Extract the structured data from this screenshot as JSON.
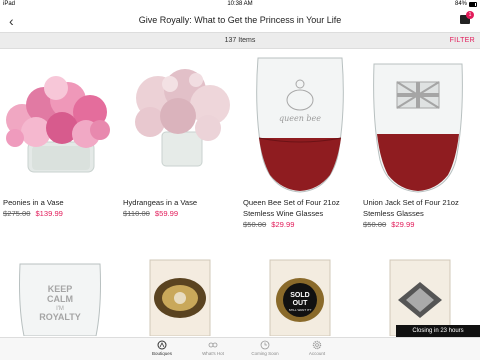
{
  "status_bar": {
    "carrier": "iPad",
    "time": "10:38 AM",
    "battery": "84%"
  },
  "nav": {
    "back_icon": "chevron-left",
    "title": "Give Royally: What to Get the Princess in Your Life",
    "cart_icon": "shopping-bag",
    "cart_count": "1"
  },
  "subbar": {
    "item_count": "137 Items",
    "filter_label": "FILTER"
  },
  "products": [
    {
      "title": "Peonies in a Vase",
      "old_price": "$275.00",
      "new_price": "$139.99"
    },
    {
      "title": "Hydrangeas in a Vase",
      "old_price": "$110.00",
      "new_price": "$59.99"
    },
    {
      "title": "Queen Bee Set of Four 21oz Stemless Wine Glasses",
      "old_price": "$50.00",
      "new_price": "$29.99",
      "image_text": "queen bee"
    },
    {
      "title": "Union Jack Set of Four 21oz Stemless Glasses",
      "old_price": "$50.00",
      "new_price": "$29.99"
    }
  ],
  "products_row2": [
    {
      "image_text_lines": [
        "KEEP",
        "CALM",
        "I'M",
        "ROYALTY"
      ]
    },
    {
      "image_text_lines": []
    },
    {
      "image_text_lines": [
        "SOLD",
        "OUT",
        "STILL WANT IT?"
      ]
    },
    {
      "image_text_lines": []
    }
  ],
  "toast": "Closing in 23 hours",
  "tabs": [
    {
      "label": "Boutiques",
      "icon": "boutiques"
    },
    {
      "label": "What's Hot",
      "icon": "glasses"
    },
    {
      "label": "Coming Soon",
      "icon": "clock"
    },
    {
      "label": "Account",
      "icon": "gear"
    }
  ],
  "colors": {
    "accent": "#e21b5a"
  }
}
